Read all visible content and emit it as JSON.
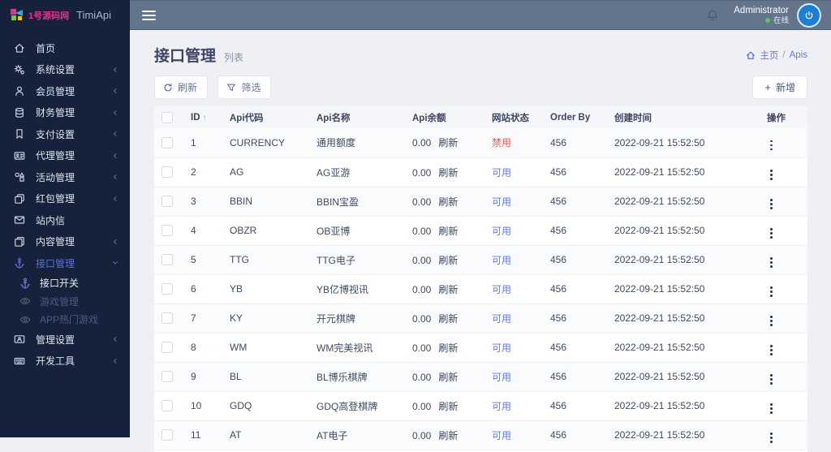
{
  "brand": {
    "logo_text": "1号源码网",
    "app_name": "TimiApi"
  },
  "colors": {
    "sidebar_bg": "#16223c",
    "topbar_bg": "#64748b",
    "primary": "#6777ef",
    "danger": "#fc544b",
    "online_dot": "#54ca68",
    "avatar_bg": "#1c7fd6"
  },
  "header": {
    "user_name": "Administrator",
    "user_status": "在线",
    "icons": [
      "menu-icon",
      "bell-icon",
      "avatar-power-icon"
    ]
  },
  "sidebar": {
    "items": [
      {
        "label": "首页",
        "icon": "home-icon"
      },
      {
        "label": "系统设置",
        "icon": "gears-icon",
        "chevron": "left"
      },
      {
        "label": "会员管理",
        "icon": "user-icon",
        "chevron": "left"
      },
      {
        "label": "财务管理",
        "icon": "database-icon",
        "chevron": "left"
      },
      {
        "label": "支付设置",
        "icon": "bookmark-icon",
        "chevron": "left"
      },
      {
        "label": "代理管理",
        "icon": "agent-card-icon",
        "chevron": "left"
      },
      {
        "label": "活动管理",
        "icon": "shapes-icon",
        "chevron": "left"
      },
      {
        "label": "红包管理",
        "icon": "clone-icon",
        "chevron": "left"
      },
      {
        "label": "站内信",
        "icon": "envelope-icon"
      },
      {
        "label": "内容管理",
        "icon": "copy-icon",
        "chevron": "left"
      },
      {
        "label": "接口管理",
        "icon": "anchor-icon",
        "chevron": "down",
        "active": true
      },
      {
        "label": "接口开关",
        "icon": "anchor-icon",
        "sub": true,
        "active": true
      },
      {
        "label": "游戏管理",
        "icon": "eye-icon",
        "sub": true
      },
      {
        "label": "APP热门游戏",
        "icon": "eye-icon",
        "sub": true
      },
      {
        "label": "管理设置",
        "icon": "id-card-icon",
        "chevron": "left"
      },
      {
        "label": "开发工具",
        "icon": "keyboard-icon",
        "chevron": "left"
      }
    ]
  },
  "page": {
    "title": "接口管理",
    "subtitle": "列表",
    "breadcrumb": {
      "home": "主页",
      "separator": "/",
      "current": "Apis"
    }
  },
  "toolbar": {
    "refresh_label": "刷新",
    "filter_label": "筛选",
    "add_label": "新增"
  },
  "table": {
    "headers": [
      "ID",
      "Api代码",
      "Api名称",
      "Api余额",
      "网站状态",
      "Order By",
      "创建时间",
      "操作"
    ],
    "sort_indicator": "↑",
    "refresh_label": "刷新",
    "rows": [
      {
        "id": "1",
        "code": "CURRENCY",
        "name": "通用额度",
        "balance": "0.00",
        "status": "禁用",
        "status_type": "disabled",
        "order_by": "456",
        "created_at": "2022-09-21 15:52:50"
      },
      {
        "id": "2",
        "code": "AG",
        "name": "AG亚游",
        "balance": "0.00",
        "status": "可用",
        "status_type": "enabled",
        "order_by": "456",
        "created_at": "2022-09-21 15:52:50"
      },
      {
        "id": "3",
        "code": "BBIN",
        "name": "BBIN宝盈",
        "balance": "0.00",
        "status": "可用",
        "status_type": "enabled",
        "order_by": "456",
        "created_at": "2022-09-21 15:52:50"
      },
      {
        "id": "4",
        "code": "OBZR",
        "name": "OB亚博",
        "balance": "0.00",
        "status": "可用",
        "status_type": "enabled",
        "order_by": "456",
        "created_at": "2022-09-21 15:52:50"
      },
      {
        "id": "5",
        "code": "TTG",
        "name": "TTG电子",
        "balance": "0.00",
        "status": "可用",
        "status_type": "enabled",
        "order_by": "456",
        "created_at": "2022-09-21 15:52:50"
      },
      {
        "id": "6",
        "code": "YB",
        "name": "YB亿博视讯",
        "balance": "0.00",
        "status": "可用",
        "status_type": "enabled",
        "order_by": "456",
        "created_at": "2022-09-21 15:52:50"
      },
      {
        "id": "7",
        "code": "KY",
        "name": "开元棋牌",
        "balance": "0.00",
        "status": "可用",
        "status_type": "enabled",
        "order_by": "456",
        "created_at": "2022-09-21 15:52:50"
      },
      {
        "id": "8",
        "code": "WM",
        "name": "WM完美视讯",
        "balance": "0.00",
        "status": "可用",
        "status_type": "enabled",
        "order_by": "456",
        "created_at": "2022-09-21 15:52:50"
      },
      {
        "id": "9",
        "code": "BL",
        "name": "BL博乐棋牌",
        "balance": "0.00",
        "status": "可用",
        "status_type": "enabled",
        "order_by": "456",
        "created_at": "2022-09-21 15:52:50"
      },
      {
        "id": "10",
        "code": "GDQ",
        "name": "GDQ高登棋牌",
        "balance": "0.00",
        "status": "可用",
        "status_type": "enabled",
        "order_by": "456",
        "created_at": "2022-09-21 15:52:50"
      },
      {
        "id": "11",
        "code": "AT",
        "name": "AT电子",
        "balance": "0.00",
        "status": "可用",
        "status_type": "enabled",
        "order_by": "456",
        "created_at": "2022-09-21 15:52:50"
      }
    ]
  }
}
